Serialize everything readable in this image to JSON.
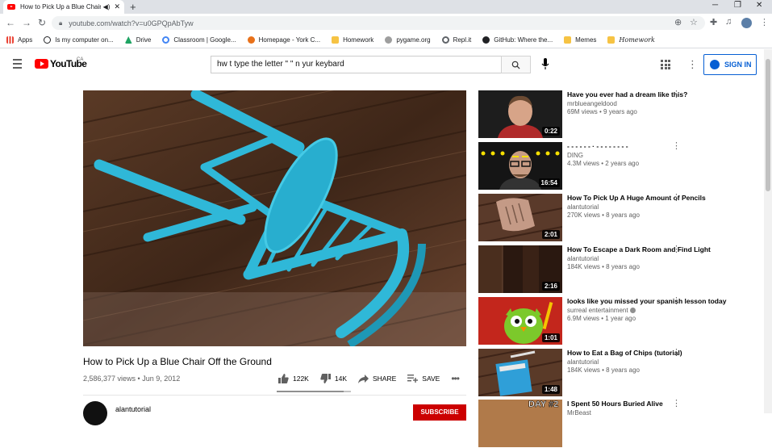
{
  "browser": {
    "tab_title": "How to Pick Up a Blue Chair",
    "url": "youtube.com/watch?v=u0GPQpAbTyw"
  },
  "bookmarks": [
    "Apps",
    "Is my computer on...",
    "Drive",
    "Classroom | Google...",
    "Homepage - York C...",
    "Homework",
    "pygame.org",
    "Repl.it",
    "GitHub: Where the...",
    "Memes",
    "Homework"
  ],
  "bookmark_colors": [
    "#ea4335",
    "#202124",
    "#1fa463",
    "#4285f4",
    "#e8711a",
    "#f6c344",
    "#9e9e9e",
    "#5f6368",
    "#202124",
    "#f6c344",
    "#f6c344"
  ],
  "youtube": {
    "logo": "YouTube",
    "country": "CA",
    "search_value": "hw t type the letter \" \" n yur keybard",
    "sign_in": "SIGN IN"
  },
  "video": {
    "title": "How to Pick Up a Blue Chair Off the Ground",
    "views": "2,586,377 views",
    "date": "Jun 9, 2012",
    "likes": "122K",
    "dislikes": "14K",
    "share": "SHARE",
    "save": "SAVE",
    "like_ratio": 0.9,
    "channel": "alantutorial",
    "subscribe": "SUBSCRIBE"
  },
  "recommendations": [
    {
      "title": "Have you ever had a dream like this?",
      "channel": "mrblueangeldood",
      "views": "69M views",
      "age": "9 years ago",
      "duration": "0:22"
    },
    {
      "title": "- - - - - - · - - - - - - - -",
      "channel": "DING",
      "views": "4.3M views",
      "age": "2 years ago",
      "duration": "16:54"
    },
    {
      "title": "How To Pick Up A Huge Amount of Pencils",
      "channel": "alantutorial",
      "views": "270K views",
      "age": "8 years ago",
      "duration": "2:01"
    },
    {
      "title": "How To Escape a Dark Room and Find Light",
      "channel": "alantutorial",
      "views": "184K views",
      "age": "8 years ago",
      "duration": "2:16"
    },
    {
      "title": "looks like you missed your spanish lesson today",
      "channel": "surreal entertainment",
      "views": "6.9M views",
      "age": "1 year ago",
      "duration": "1:01"
    },
    {
      "title": "How to Eat a Bag of Chips (tutorial)",
      "channel": "alantutorial",
      "views": "184K views",
      "age": "8 years ago",
      "duration": "1:48"
    },
    {
      "title": "I Spent 50 Hours Buried Alive",
      "channel": "MrBeast",
      "views": "",
      "age": "",
      "duration": "",
      "thumb_text": "DAY #2"
    }
  ]
}
